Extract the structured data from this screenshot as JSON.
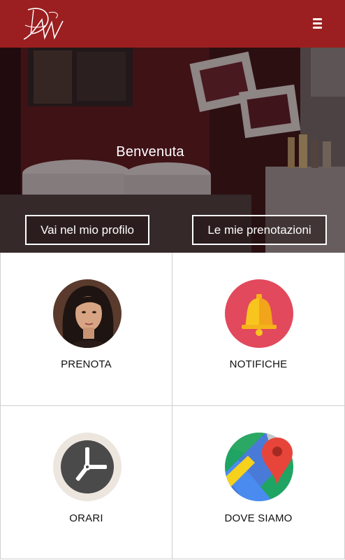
{
  "header": {
    "logo_icon": "dm-monogram-logo-icon",
    "menu_icon": "hamburger-menu-icon",
    "brand_color": "#9b1f20"
  },
  "hero": {
    "title": "Benvenuta",
    "profile_button": "Vai nel mio profilo",
    "bookings_button": "Le mie prenotazioni"
  },
  "tiles": [
    {
      "label": "PRENOTA",
      "icon": "woman-portrait-icon"
    },
    {
      "label": "NOTIFICHE",
      "icon": "bell-icon",
      "color": "#e2495c"
    },
    {
      "label": "ORARI",
      "icon": "clock-icon"
    },
    {
      "label": "DOVE SIAMO",
      "icon": "map-pin-icon"
    }
  ]
}
